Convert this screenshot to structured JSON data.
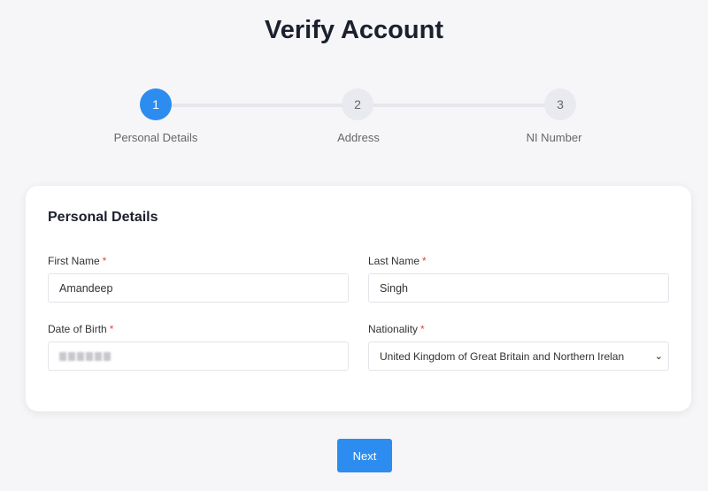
{
  "title": "Verify Account",
  "steps": [
    {
      "number": "1",
      "label": "Personal Details",
      "active": true
    },
    {
      "number": "2",
      "label": "Address",
      "active": false
    },
    {
      "number": "3",
      "label": "NI Number",
      "active": false
    }
  ],
  "form": {
    "heading": "Personal Details",
    "first_name": {
      "label": "First Name",
      "required": "*",
      "value": "Amandeep"
    },
    "last_name": {
      "label": "Last Name",
      "required": "*",
      "value": "Singh"
    },
    "dob": {
      "label": "Date of Birth",
      "required": "*"
    },
    "nationality": {
      "label": "Nationality",
      "required": "*",
      "value": "United Kingdom of Great Britain and Northern Irelan"
    }
  },
  "next_label": "Next",
  "colors": {
    "accent": "#2d8cf0",
    "required": "#e04848"
  }
}
